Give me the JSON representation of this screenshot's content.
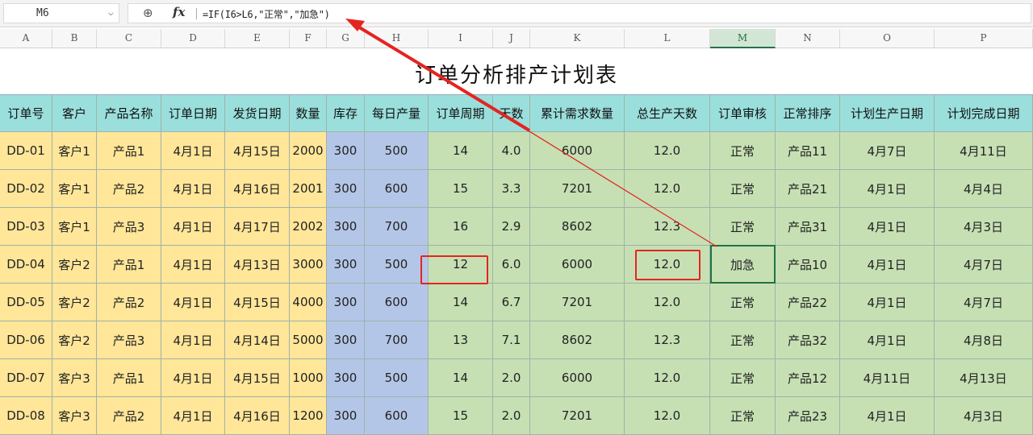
{
  "formula_bar": {
    "cell_ref": "M6",
    "formula": "=IF(I6>L6,\"正常\",\"加急\")",
    "dropdown_icon": "chevron-down-icon",
    "zoom_icon": "zoom-icon",
    "fx_label": "fx"
  },
  "columns": [
    "A",
    "B",
    "C",
    "D",
    "E",
    "F",
    "G",
    "H",
    "I",
    "J",
    "K",
    "L",
    "M",
    "N",
    "O",
    "P"
  ],
  "selected_column": "M",
  "title": "订单分析排产计划表",
  "headers": [
    "订单号",
    "客户",
    "产品名称",
    "订单日期",
    "发货日期",
    "数量",
    "库存",
    "每日产量",
    "订单周期",
    "天数",
    "累计需求数量",
    "总生产天数",
    "订单审核",
    "正常排序",
    "计划生产日期",
    "计划完成日期"
  ],
  "rows": [
    [
      "DD-01",
      "客户1",
      "产品1",
      "4月1日",
      "4月15日",
      "2000",
      "300",
      "500",
      "14",
      "4.0",
      "6000",
      "12.0",
      "正常",
      "产品11",
      "4月7日",
      "4月11日"
    ],
    [
      "DD-02",
      "客户1",
      "产品2",
      "4月1日",
      "4月16日",
      "2001",
      "300",
      "600",
      "15",
      "3.3",
      "7201",
      "12.0",
      "正常",
      "产品21",
      "4月1日",
      "4月4日"
    ],
    [
      "DD-03",
      "客户1",
      "产品3",
      "4月1日",
      "4月17日",
      "2002",
      "300",
      "700",
      "16",
      "2.9",
      "8602",
      "12.3",
      "正常",
      "产品31",
      "4月1日",
      "4月3日"
    ],
    [
      "DD-04",
      "客户2",
      "产品1",
      "4月1日",
      "4月13日",
      "3000",
      "300",
      "500",
      "12",
      "6.0",
      "6000",
      "12.0",
      "加急",
      "产品10",
      "4月1日",
      "4月7日"
    ],
    [
      "DD-05",
      "客户2",
      "产品2",
      "4月1日",
      "4月15日",
      "4000",
      "300",
      "600",
      "14",
      "6.7",
      "7201",
      "12.0",
      "正常",
      "产品22",
      "4月1日",
      "4月7日"
    ],
    [
      "DD-06",
      "客户2",
      "产品3",
      "4月1日",
      "4月14日",
      "5000",
      "300",
      "700",
      "13",
      "7.1",
      "8602",
      "12.3",
      "正常",
      "产品32",
      "4月1日",
      "4月8日"
    ],
    [
      "DD-07",
      "客户3",
      "产品1",
      "4月1日",
      "4月15日",
      "1000",
      "300",
      "500",
      "14",
      "2.0",
      "6000",
      "12.0",
      "正常",
      "产品12",
      "4月11日",
      "4月13日"
    ],
    [
      "DD-08",
      "客户3",
      "产品2",
      "4月1日",
      "4月16日",
      "1200",
      "300",
      "600",
      "15",
      "2.0",
      "7201",
      "12.0",
      "正常",
      "产品23",
      "4月1日",
      "4月3日"
    ]
  ],
  "colors": {
    "header_fill": "#9adfdc",
    "yellow_fill": "#ffe699",
    "blue_fill": "#b4c6e7",
    "green_fill": "#c6e0b4",
    "annotation_red": "#e52420",
    "selection_green": "#217346"
  }
}
